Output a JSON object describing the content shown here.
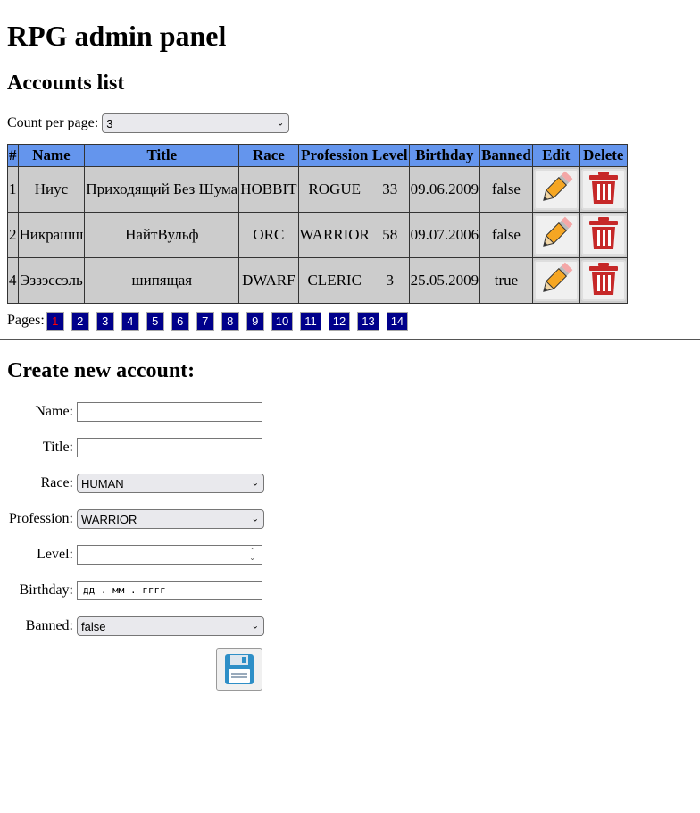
{
  "header": {
    "title": "RPG admin panel"
  },
  "accounts": {
    "heading": "Accounts list",
    "count_label": "Count per page:",
    "count_value": "3",
    "columns": [
      "#",
      "Name",
      "Title",
      "Race",
      "Profession",
      "Level",
      "Birthday",
      "Banned",
      "Edit",
      "Delete"
    ],
    "rows": [
      {
        "id": "1",
        "name": "Ниус",
        "title": "Приходящий Без Шума",
        "race": "HOBBIT",
        "profession": "ROGUE",
        "level": "33",
        "birthday": "09.06.2009",
        "banned": "false"
      },
      {
        "id": "2",
        "name": "Никрашш",
        "title": "НайтВульф",
        "race": "ORC",
        "profession": "WARRIOR",
        "level": "58",
        "birthday": "09.07.2006",
        "banned": "false"
      },
      {
        "id": "4",
        "name": "Эззэссэль",
        "title": "шипящая",
        "race": "DWARF",
        "profession": "CLERIC",
        "level": "3",
        "birthday": "25.05.2009",
        "banned": "true"
      }
    ],
    "edit_icon": "pencil-icon",
    "delete_icon": "trash-icon"
  },
  "pagination": {
    "label": "Pages:",
    "pages": [
      "1",
      "2",
      "3",
      "4",
      "5",
      "6",
      "7",
      "8",
      "9",
      "10",
      "11",
      "12",
      "13",
      "14"
    ],
    "active": "1"
  },
  "create": {
    "heading": "Create new account:",
    "name_label": "Name:",
    "name_value": "",
    "title_label": "Title:",
    "title_value": "",
    "race_label": "Race:",
    "race_value": "HUMAN",
    "profession_label": "Profession:",
    "profession_value": "WARRIOR",
    "level_label": "Level:",
    "level_value": "",
    "birthday_label": "Birthday:",
    "birthday_placeholder": "дд . мм . гггг",
    "banned_label": "Banned:",
    "banned_value": "false",
    "save_icon": "floppy-save-icon"
  },
  "colors": {
    "header_bg": "#6495ed",
    "cell_bg": "#cccccc",
    "page_btn_bg": "#00008b",
    "active_page": "#ff0000"
  }
}
